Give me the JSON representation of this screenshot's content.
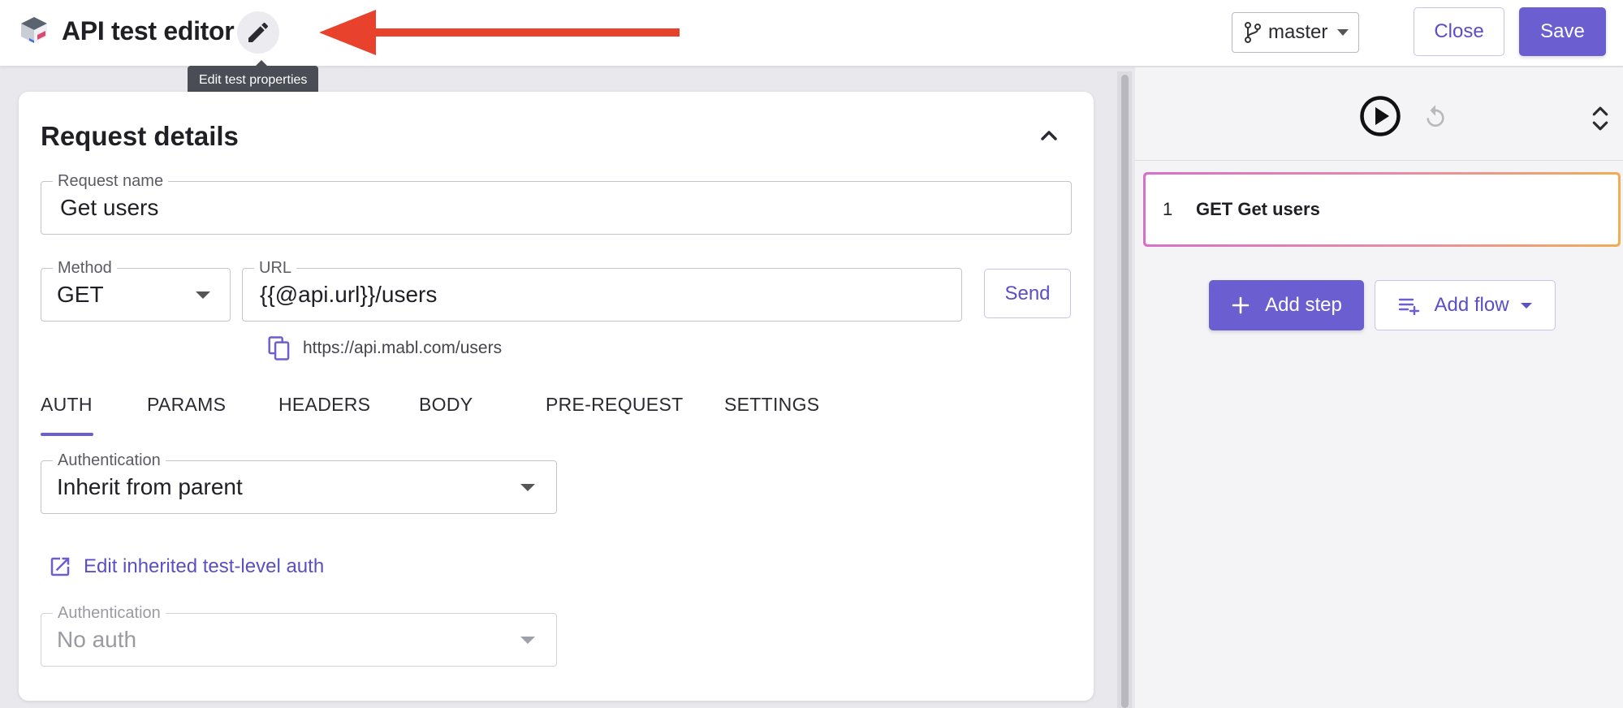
{
  "header": {
    "title": "API test editor",
    "edit_tooltip": "Edit test properties",
    "branch": "master",
    "close_label": "Close",
    "save_label": "Save"
  },
  "request": {
    "section_title": "Request details",
    "name_label": "Request name",
    "name_value": "Get users",
    "method_label": "Method",
    "method_value": "GET",
    "url_label": "URL",
    "url_value": "{{@api.url}}/users",
    "send_label": "Send",
    "resolved_url": "https://api.mabl.com/users",
    "tabs": [
      {
        "label": "AUTH",
        "active": true
      },
      {
        "label": "PARAMS",
        "active": false
      },
      {
        "label": "HEADERS",
        "active": false
      },
      {
        "label": "BODY",
        "active": false
      },
      {
        "label": "PRE-REQUEST",
        "active": false
      },
      {
        "label": "SETTINGS",
        "active": false
      }
    ],
    "auth_label": "Authentication",
    "auth_value": "Inherit from parent",
    "edit_auth_link": "Edit inherited test-level auth",
    "inherited_auth_label": "Authentication",
    "inherited_auth_value": "No auth"
  },
  "steps_panel": {
    "steps": [
      {
        "number": "1",
        "label": "GET Get users"
      }
    ],
    "add_step_label": "Add step",
    "add_flow_label": "Add flow"
  },
  "colors": {
    "accent": "#6a5ed0",
    "arrow": "#e8412c",
    "step_border_start": "#d770c9",
    "step_border_end": "#f0ad55"
  }
}
